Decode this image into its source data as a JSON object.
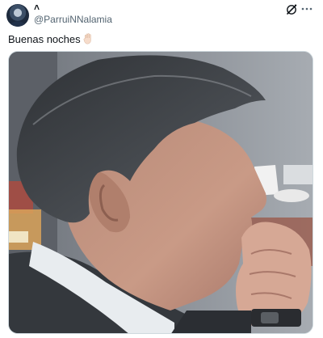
{
  "author": {
    "display_name": "˄",
    "handle": "@ParruiNNalamia"
  },
  "tweet": {
    "text": "Buenas noches"
  },
  "icons": {
    "grok": "grok-icon",
    "more": "more-icon",
    "emoji": "raised-hand-emoji"
  },
  "colors": {
    "text_primary": "#0f1419",
    "text_secondary": "#536471",
    "border": "#cfd9de"
  }
}
